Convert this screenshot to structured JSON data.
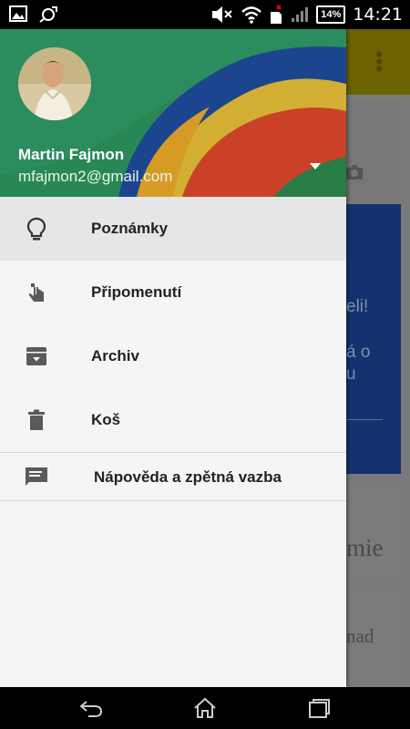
{
  "status_bar": {
    "time": "14:21",
    "battery": "14%",
    "icons": [
      "gallery-icon",
      "sync-icon",
      "mute-icon",
      "wifi-icon",
      "sim-icon",
      "signal-icon",
      "battery-icon"
    ]
  },
  "drawer": {
    "user": {
      "name": "Martin Fajmon",
      "email": "mfajmon2@gmail.com"
    },
    "items": [
      {
        "label": "Poznámky",
        "icon": "lightbulb-icon",
        "active": true
      },
      {
        "label": "Připomenutí",
        "icon": "reminder-hand-icon",
        "active": false
      },
      {
        "label": "Archiv",
        "icon": "archive-icon",
        "active": false
      },
      {
        "label": "Koš",
        "icon": "trash-icon",
        "active": false
      }
    ],
    "footer_item": {
      "label": "Nápověda a zpětná vazba",
      "icon": "feedback-icon"
    }
  },
  "background": {
    "card_texts": [
      "eli!",
      "á o",
      "u",
      "mie",
      "nad"
    ]
  },
  "nav_bar": {
    "buttons": [
      "back-icon",
      "home-icon",
      "recents-icon"
    ]
  },
  "colors": {
    "toolbar": "#f6d100",
    "drawer_bg": "#f5f5f5",
    "active_item": "#e6e6e6",
    "blue_card": "#2e6ae6"
  }
}
